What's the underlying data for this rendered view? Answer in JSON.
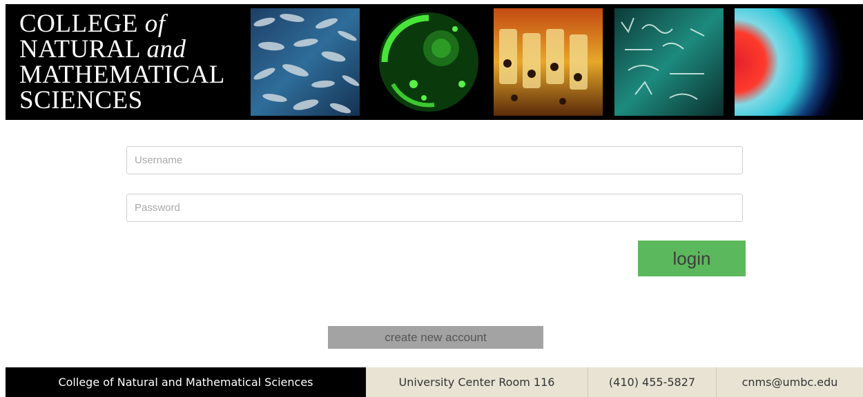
{
  "header": {
    "title_line1_word": "COLLEGE",
    "title_line1_italic": "of",
    "title_line2_word": "NATURAL",
    "title_line2_italic": "and",
    "title_line3": "MATHEMATICAL",
    "title_line4": "SCIENCES",
    "images": [
      "fish-school-photo",
      "green-cell-photo",
      "lab-glassware-photo",
      "chalkboard-equations-photo",
      "red-blue-rings-photo"
    ]
  },
  "login_form": {
    "username_placeholder": "Username",
    "username_value": "",
    "password_placeholder": "Password",
    "password_value": "",
    "login_label": "login",
    "create_account_label": "create new account"
  },
  "footer": {
    "college": "College of Natural and Mathematical Sciences",
    "room": "University Center Room 116",
    "phone": "(410) 455-5827",
    "email": "cnms@umbc.edu"
  },
  "colors": {
    "banner": "#000000",
    "login_button": "#5cb85c",
    "create_button": "#a3a3a3",
    "footer_dark": "#000000",
    "footer_light": "#e8e3d3"
  }
}
